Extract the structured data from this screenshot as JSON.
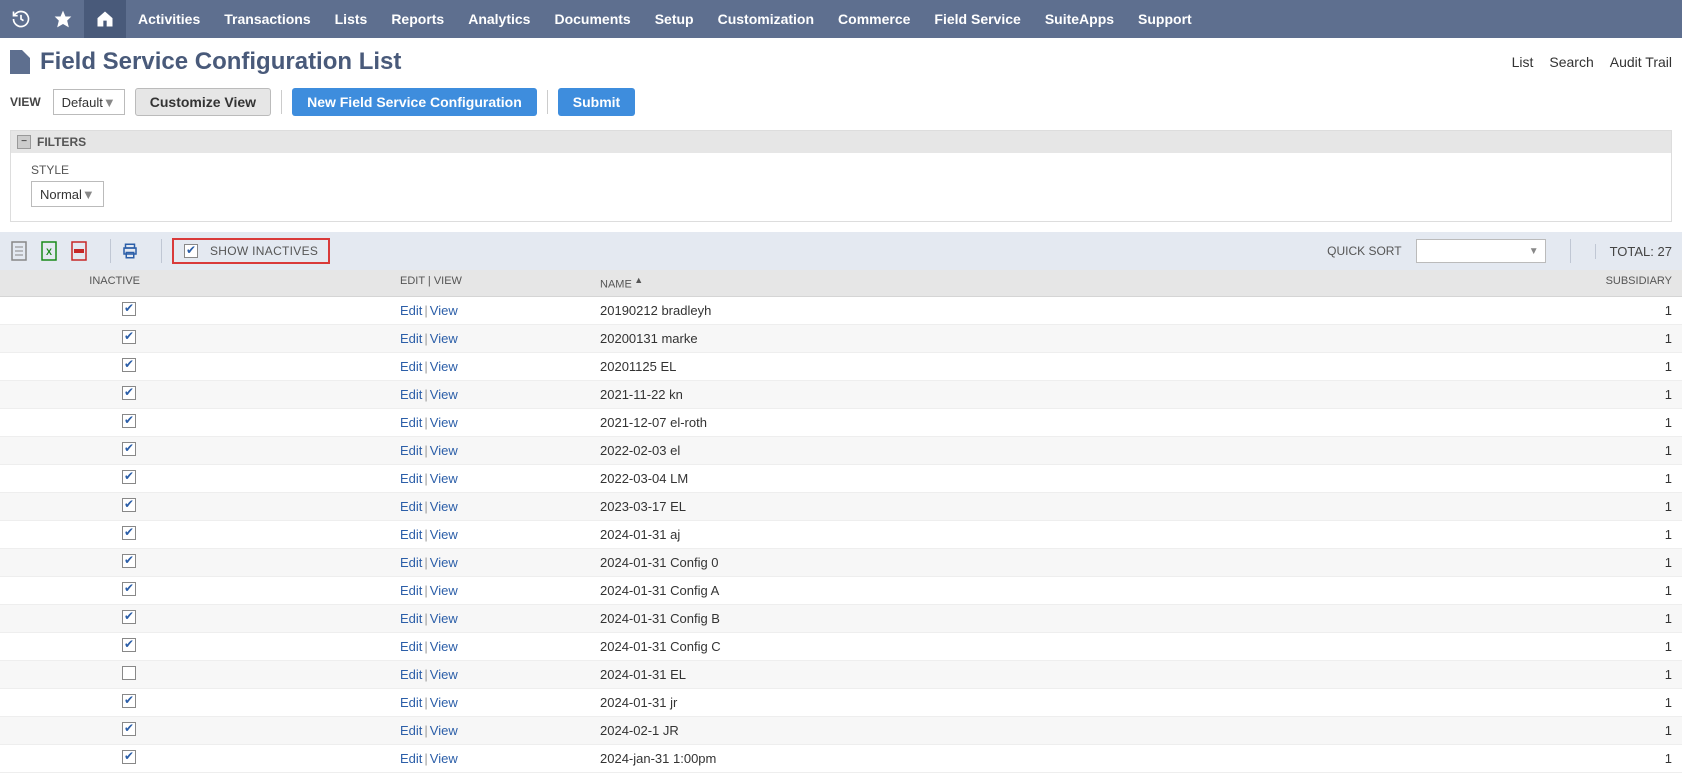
{
  "nav": {
    "items": [
      "Activities",
      "Transactions",
      "Lists",
      "Reports",
      "Analytics",
      "Documents",
      "Setup",
      "Customization",
      "Commerce",
      "Field Service",
      "SuiteApps",
      "Support"
    ]
  },
  "header": {
    "title": "Field Service Configuration List",
    "links": [
      "List",
      "Search",
      "Audit Trail"
    ]
  },
  "actions": {
    "view_label": "VIEW",
    "view_value": "Default",
    "customize": "Customize View",
    "new_config": "New Field Service Configuration",
    "submit": "Submit"
  },
  "filters": {
    "heading": "FILTERS",
    "style_label": "STYLE",
    "style_value": "Normal"
  },
  "toolbar": {
    "show_inactives_label": "SHOW INACTIVES",
    "quick_sort_label": "QUICK SORT",
    "total_label": "TOTAL:",
    "total_value": "27"
  },
  "columns": {
    "inactive": "INACTIVE",
    "editview": "EDIT | VIEW",
    "name": "NAME",
    "subsidiary": "SUBSIDIARY"
  },
  "link_labels": {
    "edit": "Edit",
    "view": "View"
  },
  "rows": [
    {
      "inactive": true,
      "name": "20190212 bradleyh",
      "subsidiary": "1"
    },
    {
      "inactive": true,
      "name": "20200131 marke",
      "subsidiary": "1"
    },
    {
      "inactive": true,
      "name": "20201125 EL",
      "subsidiary": "1"
    },
    {
      "inactive": true,
      "name": "2021-11-22 kn",
      "subsidiary": "1"
    },
    {
      "inactive": true,
      "name": "2021-12-07 el-roth",
      "subsidiary": "1"
    },
    {
      "inactive": true,
      "name": "2022-02-03 el",
      "subsidiary": "1"
    },
    {
      "inactive": true,
      "name": "2022-03-04 LM",
      "subsidiary": "1"
    },
    {
      "inactive": true,
      "name": "2023-03-17 EL",
      "subsidiary": "1"
    },
    {
      "inactive": true,
      "name": "2024-01-31 aj",
      "subsidiary": "1"
    },
    {
      "inactive": true,
      "name": "2024-01-31 Config 0",
      "subsidiary": "1"
    },
    {
      "inactive": true,
      "name": "2024-01-31 Config A",
      "subsidiary": "1"
    },
    {
      "inactive": true,
      "name": "2024-01-31 Config B",
      "subsidiary": "1"
    },
    {
      "inactive": true,
      "name": "2024-01-31 Config C",
      "subsidiary": "1"
    },
    {
      "inactive": false,
      "name": "2024-01-31 EL",
      "subsidiary": "1"
    },
    {
      "inactive": true,
      "name": "2024-01-31 jr",
      "subsidiary": "1"
    },
    {
      "inactive": true,
      "name": "2024-02-1 JR",
      "subsidiary": "1"
    },
    {
      "inactive": true,
      "name": "2024-jan-31 1:00pm",
      "subsidiary": "1"
    }
  ]
}
